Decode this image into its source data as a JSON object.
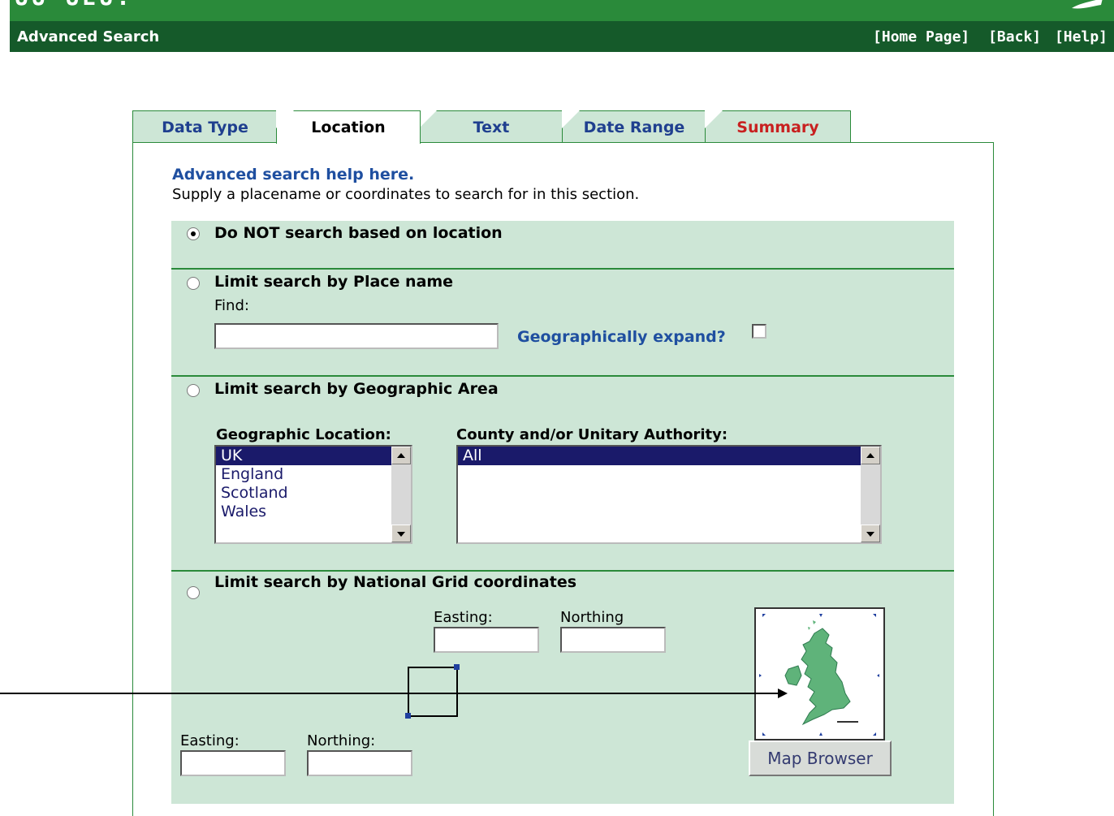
{
  "header": {
    "top_cut_text": "UU UEU.",
    "title": "Advanced Search",
    "links": [
      "[Home Page]",
      "[Back]",
      "[Help]"
    ]
  },
  "tabs": [
    {
      "label": "Data Type"
    },
    {
      "label": "Location"
    },
    {
      "label": "Text"
    },
    {
      "label": "Date Range"
    },
    {
      "label": "Summary"
    }
  ],
  "intro": {
    "help_link": "Advanced search help here.",
    "description": "Supply a placename or coordinates to search for in this section."
  },
  "options": {
    "no_location": "Do NOT search based on location",
    "place_name": "Limit search by Place name",
    "find_label": "Find:",
    "find_value": "",
    "expand_label": "Geographically expand?",
    "geo_area": "Limit search by Geographic Area",
    "geo_location_label": "Geographic Location:",
    "county_label": "County and/or Unitary Authority:",
    "grid": "Limit search by National Grid coordinates",
    "easting_label": "Easting:",
    "northing_label": "Northing",
    "easting_label_2": "Easting:",
    "northing_label_2": "Northing:",
    "map_button": "Map Browser"
  },
  "lists": {
    "geo_locations": [
      "UK",
      "England",
      "Scotland",
      "Wales"
    ],
    "counties": [
      "All"
    ]
  },
  "colors": {
    "accent_green": "#2a8a3a",
    "header_dark_green": "#155a2a",
    "form_bg": "#cde6d6",
    "link_blue": "#1f4fa0",
    "summary_red": "#c82020"
  }
}
